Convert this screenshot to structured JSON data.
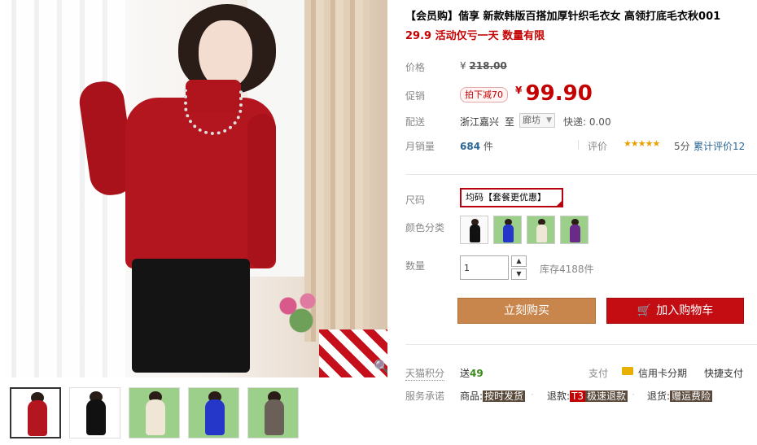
{
  "product": {
    "title": "【会员购】偕享 新款韩版百搭加厚针织毛衣女 高领打底毛衣秋001",
    "subtitle": "29.9 活动仅亏一天 数量有限"
  },
  "pricing": {
    "price_label": "价格",
    "currency": "¥",
    "original_price": "218.00",
    "promo_label": "促销",
    "discount_badge": "拍下减70",
    "promo_price": "99.90"
  },
  "shipping": {
    "label": "配送",
    "from": "浙江嘉兴",
    "to_word": "至",
    "destination": "廊坊",
    "express": "快递: 0.00"
  },
  "sales": {
    "label": "月销量",
    "count": "684",
    "unit": "件",
    "rating_label": "评价",
    "stars": "★★★★★",
    "score": "5分",
    "review_link": "累计评价12",
    "star_color": "#e8a100"
  },
  "options": {
    "size_label": "尺码",
    "size_value": "均码【套餐更优惠】",
    "color_label": "颜色分类",
    "colors": [
      "black",
      "blue",
      "cream",
      "purple"
    ]
  },
  "quantity": {
    "label": "数量",
    "value": "1",
    "up": "▲",
    "down": "▼",
    "stock": "库存4188件"
  },
  "actions": {
    "buy_now": "立刻购买",
    "add_to_cart": "加入购物车",
    "buy_color": "#c8864c",
    "cart_color": "#c40d12"
  },
  "footer": {
    "points_label": "天猫积分",
    "points_prefix": "送",
    "points_value": "49",
    "pay_label": "支付",
    "pay_installment": "信用卡分期",
    "pay_fast": "快捷支付",
    "service_label": "服务承诺",
    "service_goods_prefix": "商品:",
    "service_goods_tag": "按时发货",
    "service_refund_prefix": "退款:",
    "service_refund_badge": "T3",
    "service_refund_tag": "极速退款",
    "service_return_prefix": "退货:",
    "service_return_tag": "赠运费险"
  },
  "gallery": {
    "thumbnails": [
      "red",
      "black",
      "cream",
      "blue",
      "grey"
    ],
    "zoom_icon": "magnifier-icon"
  }
}
